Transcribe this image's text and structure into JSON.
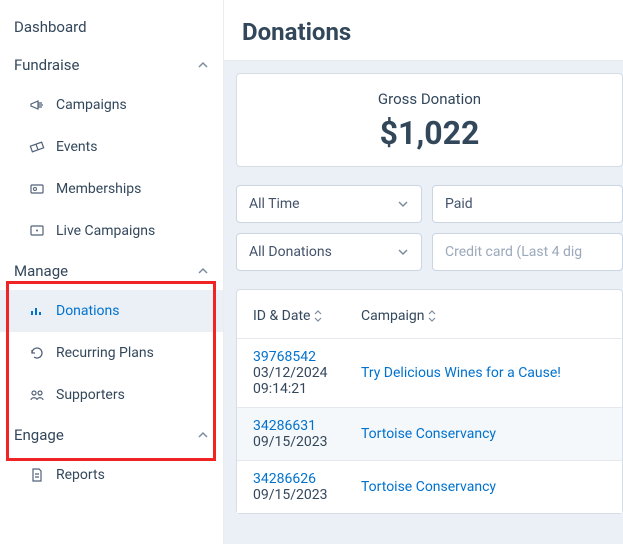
{
  "sidebar": {
    "dashboard": "Dashboard",
    "fundraise": {
      "label": "Fundraise",
      "items": [
        {
          "label": "Campaigns"
        },
        {
          "label": "Events"
        },
        {
          "label": "Memberships"
        },
        {
          "label": "Live Campaigns"
        }
      ]
    },
    "manage": {
      "label": "Manage",
      "items": [
        {
          "label": "Donations"
        },
        {
          "label": "Recurring Plans"
        },
        {
          "label": "Supporters"
        }
      ]
    },
    "engage": {
      "label": "Engage",
      "items": [
        {
          "label": "Reports"
        }
      ]
    }
  },
  "page": {
    "title": "Donations"
  },
  "summary": {
    "label": "Gross Donation",
    "value": "$1,022"
  },
  "filters": {
    "time": "All Time",
    "status": "Paid",
    "type": "All Donations",
    "search_placeholder": "Credit card (Last 4 dig"
  },
  "table": {
    "headers": {
      "id_date": "ID & Date",
      "campaign": "Campaign"
    },
    "rows": [
      {
        "id": "39768542",
        "date": "03/12/2024",
        "time": "09:14:21",
        "campaign": "Try Delicious Wines for a Cause!"
      },
      {
        "id": "34286631",
        "date": "09/15/2023",
        "time": "",
        "campaign": "Tortoise Conservancy"
      },
      {
        "id": "34286626",
        "date": "09/15/2023",
        "time": "",
        "campaign": "Tortoise Conservancy"
      }
    ]
  }
}
